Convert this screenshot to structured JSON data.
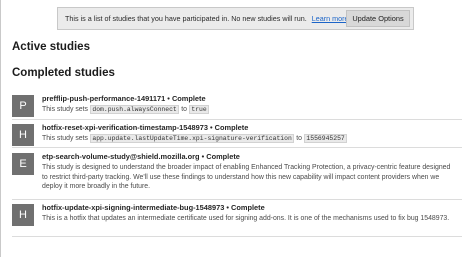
{
  "notice": {
    "message": "This is a list of studies that you have participated in. No new studies will run.",
    "link": "Learn more",
    "button": "Update Options"
  },
  "active_heading": "Active studies",
  "completed_heading": "Completed studies",
  "studies": [
    {
      "initial": "P",
      "name": "prefflip-push-performance-1491171",
      "separator": "•",
      "status": "Complete",
      "desc_prefix": "This study sets",
      "code1": "dom.push.alwaysConnect",
      "desc_mid": "to",
      "code2": "true"
    },
    {
      "initial": "H",
      "name": "hotfix-reset-xpi-verification-timestamp-1548973",
      "separator": "•",
      "status": "Complete",
      "desc_prefix": "This study sets",
      "code1": "app.update.lastUpdateTime.xpi-signature-verification",
      "desc_mid": "to",
      "code2": "1556945257"
    },
    {
      "initial": "E",
      "name": "etp-search-volume-study@shield.mozilla.org",
      "separator": "•",
      "status": "Complete",
      "description": "This study is designed to understand the broader impact of enabling Enhanced Tracking Protection, a privacy-centric feature designed to restrict third-party tracking. We'll use these findings to understand how this new capability will impact content providers when we deploy it more broadly in the future."
    },
    {
      "initial": "H",
      "name": "hotfix-update-xpi-signing-intermediate-bug-1548973",
      "separator": "•",
      "status": "Complete",
      "description": "This is a hotfix that updates an intermediate certificate used for signing add-ons. It is one of the mechanisms used to fix bug 1548973."
    }
  ]
}
